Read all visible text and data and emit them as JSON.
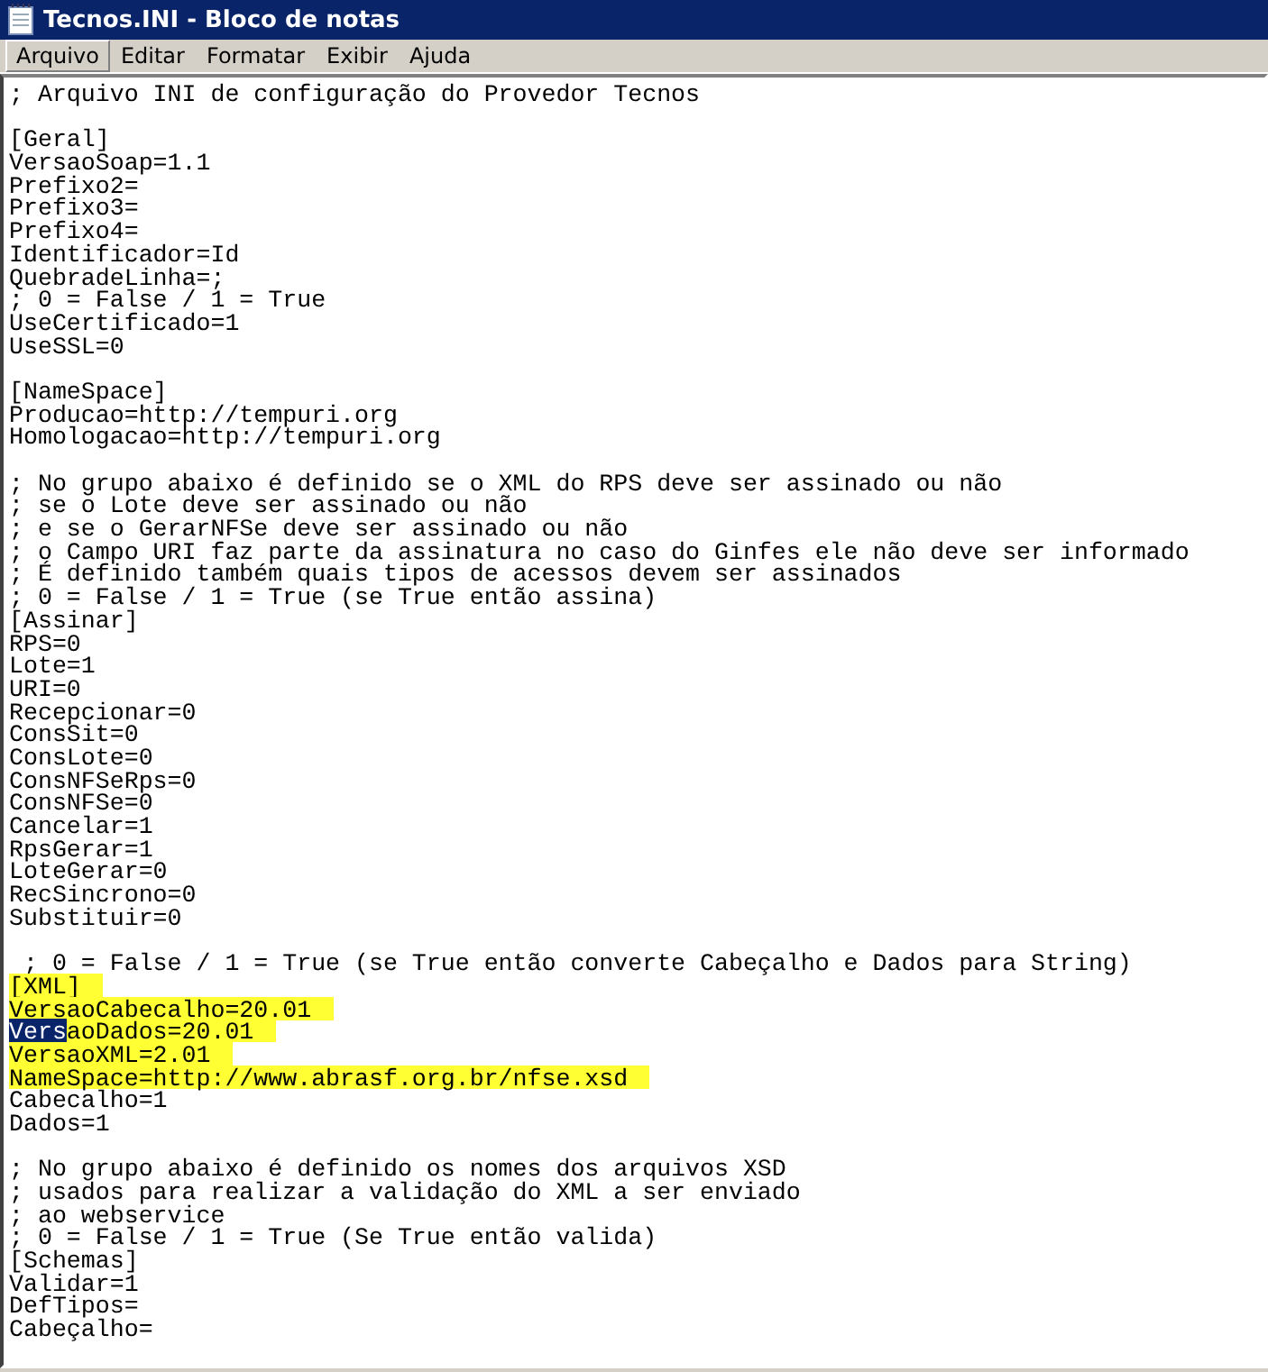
{
  "window": {
    "title": "Tecnos.INI - Bloco de notas"
  },
  "menu": [
    {
      "label": "Arquivo",
      "selected": true
    },
    {
      "label": "Editar",
      "selected": false
    },
    {
      "label": "Formatar",
      "selected": false
    },
    {
      "label": "Exibir",
      "selected": false
    },
    {
      "label": "Ajuda",
      "selected": false
    }
  ],
  "lines": [
    {
      "kind": "text",
      "text": "; Arquivo INI de configuração do Provedor Tecnos"
    },
    {
      "kind": "blank"
    },
    {
      "kind": "text",
      "text": "[Geral]"
    },
    {
      "kind": "text",
      "text": "VersaoSoap=1.1"
    },
    {
      "kind": "text",
      "text": "Prefixo2="
    },
    {
      "kind": "text",
      "text": "Prefixo3="
    },
    {
      "kind": "text",
      "text": "Prefixo4="
    },
    {
      "kind": "text",
      "text": "Identificador=Id"
    },
    {
      "kind": "text",
      "text": "QuebradeLinha=;"
    },
    {
      "kind": "text",
      "text": "; 0 = False / 1 = True"
    },
    {
      "kind": "text",
      "text": "UseCertificado=1"
    },
    {
      "kind": "text",
      "text": "UseSSL=0"
    },
    {
      "kind": "blank"
    },
    {
      "kind": "text",
      "text": "[NameSpace]"
    },
    {
      "kind": "text",
      "text": "Producao=http://tempuri.org"
    },
    {
      "kind": "text",
      "text": "Homologacao=http://tempuri.org"
    },
    {
      "kind": "blank"
    },
    {
      "kind": "text",
      "text": "; No grupo abaixo é definido se o XML do RPS deve ser assinado ou não"
    },
    {
      "kind": "text",
      "text": "; se o Lote deve ser assinado ou não"
    },
    {
      "kind": "text",
      "text": "; e se o GerarNFSe deve ser assinado ou não"
    },
    {
      "kind": "text",
      "text": "; o Campo URI faz parte da assinatura no caso do Ginfes ele não deve ser informado"
    },
    {
      "kind": "text",
      "text": "; É definido também quais tipos de acessos devem ser assinados"
    },
    {
      "kind": "text",
      "text": "; 0 = False / 1 = True (se True então assina)"
    },
    {
      "kind": "text",
      "text": "[Assinar]"
    },
    {
      "kind": "text",
      "text": "RPS=0"
    },
    {
      "kind": "text",
      "text": "Lote=1"
    },
    {
      "kind": "text",
      "text": "URI=0"
    },
    {
      "kind": "text",
      "text": "Recepcionar=0"
    },
    {
      "kind": "text",
      "text": "ConsSit=0"
    },
    {
      "kind": "text",
      "text": "ConsLote=0"
    },
    {
      "kind": "text",
      "text": "ConsNFSeRps=0"
    },
    {
      "kind": "text",
      "text": "ConsNFSe=0"
    },
    {
      "kind": "text",
      "text": "Cancelar=1"
    },
    {
      "kind": "text",
      "text": "RpsGerar=1"
    },
    {
      "kind": "text",
      "text": "LoteGerar=0"
    },
    {
      "kind": "text",
      "text": "RecSincrono=0"
    },
    {
      "kind": "text",
      "text": "Substituir=0"
    },
    {
      "kind": "blank"
    },
    {
      "kind": "text",
      "text": " ; 0 = False / 1 = True (se True então converte Cabeçalho e Dados para String)"
    },
    {
      "kind": "text",
      "text": "[XML]",
      "highlighted": true
    },
    {
      "kind": "text",
      "text": "VersaoCabecalho=20.01",
      "highlighted": true
    },
    {
      "kind": "text",
      "selected_text": "Vers",
      "text": "aoDados=20.01",
      "highlighted": true
    },
    {
      "kind": "text",
      "text": "VersaoXML=2.01",
      "highlighted": true
    },
    {
      "kind": "text",
      "text": "NameSpace=http://www.abrasf.org.br/nfse.xsd",
      "highlighted": true
    },
    {
      "kind": "text",
      "text": "Cabecalho=1"
    },
    {
      "kind": "text",
      "text": "Dados=1"
    },
    {
      "kind": "blank"
    },
    {
      "kind": "text",
      "text": "; No grupo abaixo é definido os nomes dos arquivos XSD"
    },
    {
      "kind": "text",
      "text": "; usados para realizar a validação do XML a ser enviado"
    },
    {
      "kind": "text",
      "text": "; ao webservice"
    },
    {
      "kind": "text",
      "text": "; 0 = False / 1 = True (Se True então valida)"
    },
    {
      "kind": "text",
      "text": "[Schemas]"
    },
    {
      "kind": "text",
      "text": "Validar=1"
    },
    {
      "kind": "text",
      "text": "DefTipos="
    },
    {
      "kind": "text",
      "text": "Cabeçalho="
    }
  ]
}
